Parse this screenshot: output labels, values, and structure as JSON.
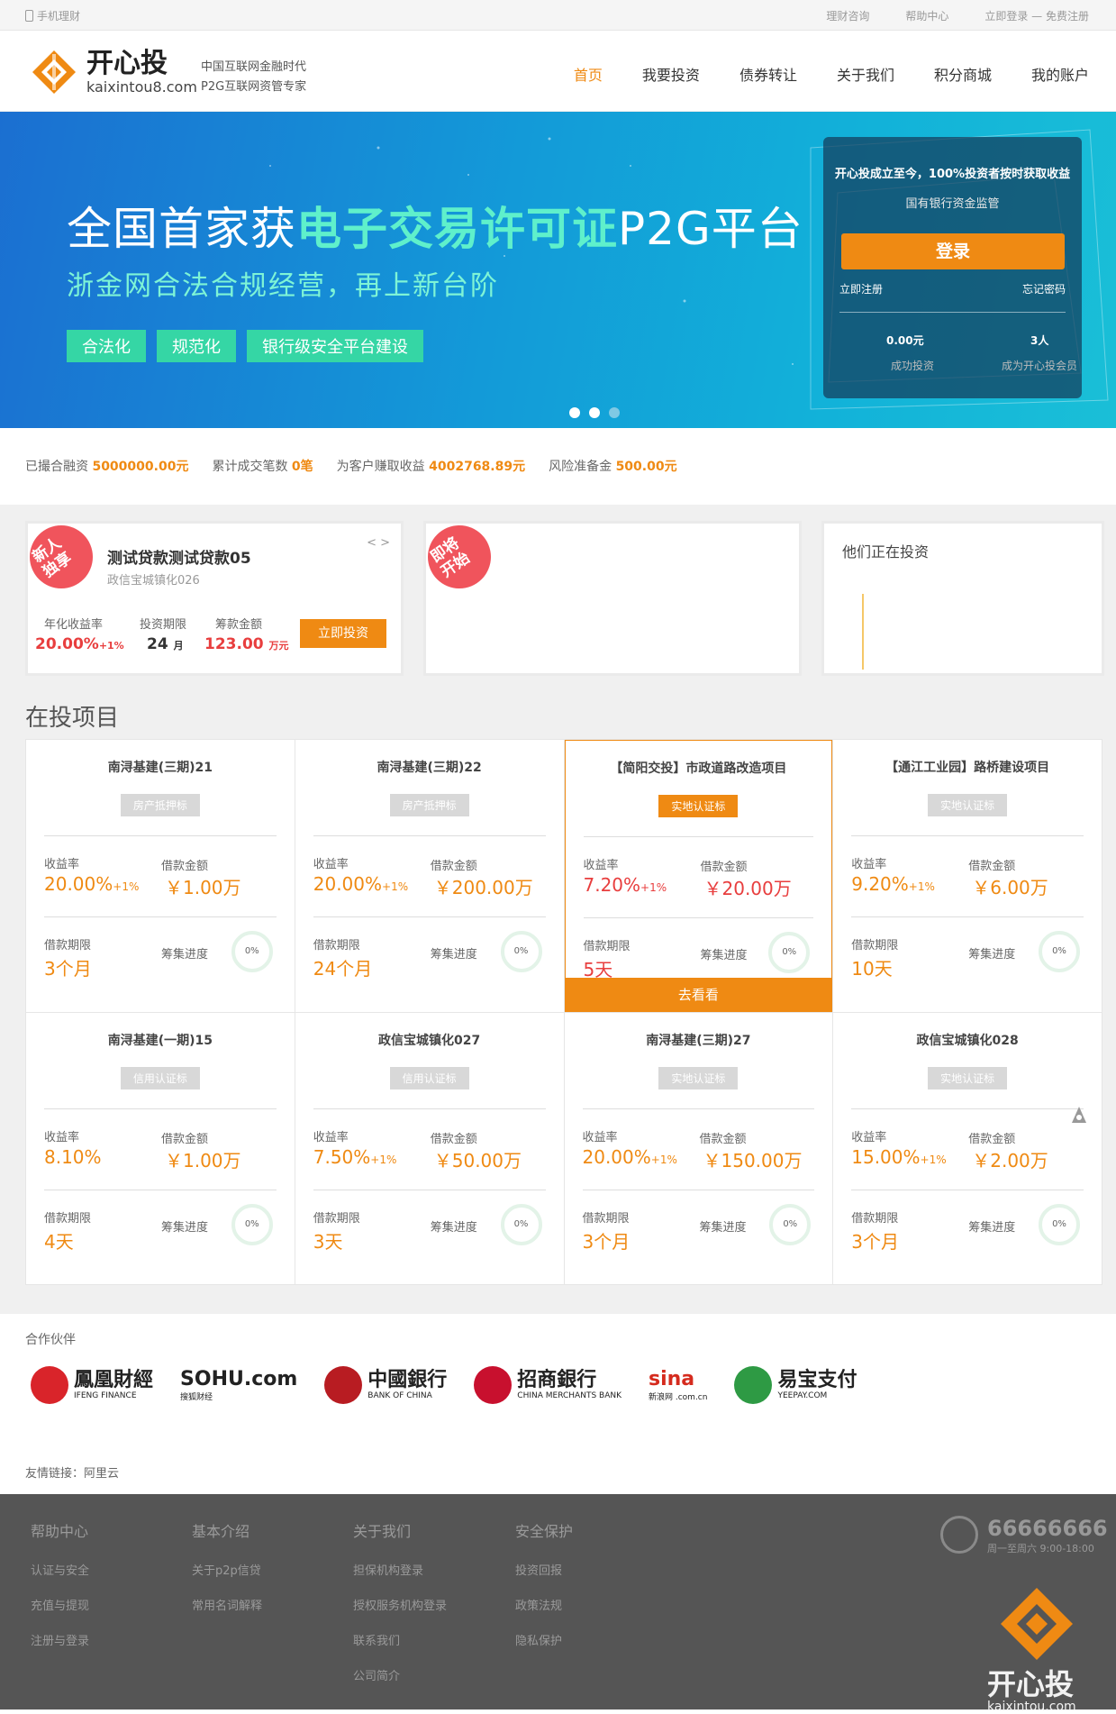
{
  "topbar": {
    "mobile": "手机理财",
    "links": [
      "理财咨询",
      "帮助中心",
      "立即登录 — 免费注册"
    ]
  },
  "brand": {
    "cn": "开心投",
    "en": "kaixintou8.com",
    "slogan1": "中国互联网金融时代",
    "slogan2": "P2G互联网资管专家",
    "color": "#ef8a13"
  },
  "nav": [
    "首页",
    "我要投资",
    "债券转让",
    "关于我们",
    "积分商城",
    "我的账户"
  ],
  "banner": {
    "title_pre": "全国首家获",
    "title_hl": "电子交易许可证",
    "title_post": "P2G平台",
    "subtitle": "浙金网合法合规经营，再上新台阶",
    "tags": [
      "合法化",
      "规范化",
      "银行级安全平台建设"
    ]
  },
  "login_box": {
    "line1": "开心投成立至今，100%投资者按时获取收益",
    "line2": "国有银行资金监管",
    "login_btn": "登录",
    "register": "立即注册",
    "forgot": "忘记密码",
    "stat1_value": "0.00元",
    "stat1_label": "成功投资",
    "stat2_value": "3人",
    "stat2_label": "成为开心投会员"
  },
  "stats": {
    "s1_label": "已撮合融资",
    "s1_value": "5000000.00元",
    "s2_label": "累计成交笔数",
    "s2_value": "0笔",
    "s3_label": "为客户赚取收益",
    "s3_value": "4002768.89元",
    "s4_label": "风险准备金",
    "s4_value": "500.00元"
  },
  "featured": {
    "ribbon": "新人\n独享",
    "name": "测试贷款测试贷款05",
    "sub": "政信宝城镇化026",
    "arrows": "< >",
    "rate_label": "年化收益率",
    "rate": "20.00%",
    "rate_extra": "+1%",
    "term_label": "投资期限",
    "term": "24",
    "term_unit": "月",
    "amount_label": "筹款金额",
    "amount": "123.00",
    "amount_unit": "万元",
    "buy": "立即投资"
  },
  "upcoming": {
    "ribbon": "即将\n开始"
  },
  "investing_now": {
    "title": "他们正在投资"
  },
  "section_title": "在投项目",
  "projects": [
    {
      "name": "南浔基建(三期)21",
      "badge": "房产抵押标",
      "rate": "20.00%",
      "extra": "+1%",
      "amount": "￥1.00万",
      "term": "3个月",
      "progress": "0%"
    },
    {
      "name": "南浔基建(三期)22",
      "badge": "房产抵押标",
      "rate": "20.00%",
      "extra": "+1%",
      "amount": "￥200.00万",
      "term": "24个月",
      "progress": "0%"
    },
    {
      "name": "【简阳交投】市政道路改造项目",
      "badge": "实地认证标",
      "rate": "7.20%",
      "extra": "+1%",
      "amount": "￥20.00万",
      "term": "5天",
      "progress": "0%",
      "go": "去看看"
    },
    {
      "name": "【通江工业园】路桥建设项目",
      "badge": "实地认证标",
      "rate": "9.20%",
      "extra": "+1%",
      "amount": "￥6.00万",
      "term": "10天",
      "progress": "0%"
    },
    {
      "name": "南浔基建(一期)15",
      "badge": "信用认证标",
      "rate": "8.10%",
      "extra": "",
      "amount": "￥1.00万",
      "term": "4天",
      "progress": "0%"
    },
    {
      "name": "政信宝城镇化027",
      "badge": "信用认证标",
      "rate": "7.50%",
      "extra": "+1%",
      "amount": "￥50.00万",
      "term": "3天",
      "progress": "0%"
    },
    {
      "name": "南浔基建(三期)27",
      "badge": "实地认证标",
      "rate": "20.00%",
      "extra": "+1%",
      "amount": "￥150.00万",
      "term": "3个月",
      "progress": "0%"
    },
    {
      "name": "政信宝城镇化028",
      "badge": "实地认证标",
      "rate": "15.00%",
      "extra": "+1%",
      "amount": "￥2.00万",
      "term": "3个月",
      "progress": "0%"
    }
  ],
  "labels": {
    "rate": "收益率",
    "amount": "借款金额",
    "term": "借款期限",
    "progress": "筹集进度"
  },
  "partners": {
    "title": "合作伙伴",
    "items": [
      {
        "cn": "鳳凰財經",
        "en": "IFENG FINANCE",
        "color": "#d9242a"
      },
      {
        "cn": "SOHU.com",
        "en": "搜狐财经",
        "color": "#222"
      },
      {
        "cn": "中國銀行",
        "en": "BANK OF CHINA",
        "color": "#b81c22"
      },
      {
        "cn": "招商銀行",
        "en": "CHINA MERCHANTS BANK",
        "color": "#c8102e"
      },
      {
        "cn": "sina",
        "en": "新浪网 .com.cn",
        "color": "#d52b1e"
      },
      {
        "cn": "易宝支付",
        "en": "YEEPAY.COM",
        "color": "#2e9a44"
      }
    ],
    "friends": "友情链接：阿里云"
  },
  "footer": {
    "cols": [
      {
        "h": "帮助中心",
        "items": [
          "认证与安全",
          "充值与提现",
          "注册与登录"
        ]
      },
      {
        "h": "基本介绍",
        "items": [
          "关于p2p信贷",
          "常用名词解释"
        ]
      },
      {
        "h": "关于我们",
        "items": [
          "担保机构登录",
          "授权服务机构登录",
          "联系我们",
          "公司简介"
        ]
      },
      {
        "h": "安全保护",
        "items": [
          "投资回报",
          "政策法规",
          "隐私保护"
        ]
      }
    ],
    "phone": "66666666",
    "hours": "周一至周六 9:00-18:00",
    "logo_cn": "开心投",
    "logo_en": "kaixintou.com"
  }
}
